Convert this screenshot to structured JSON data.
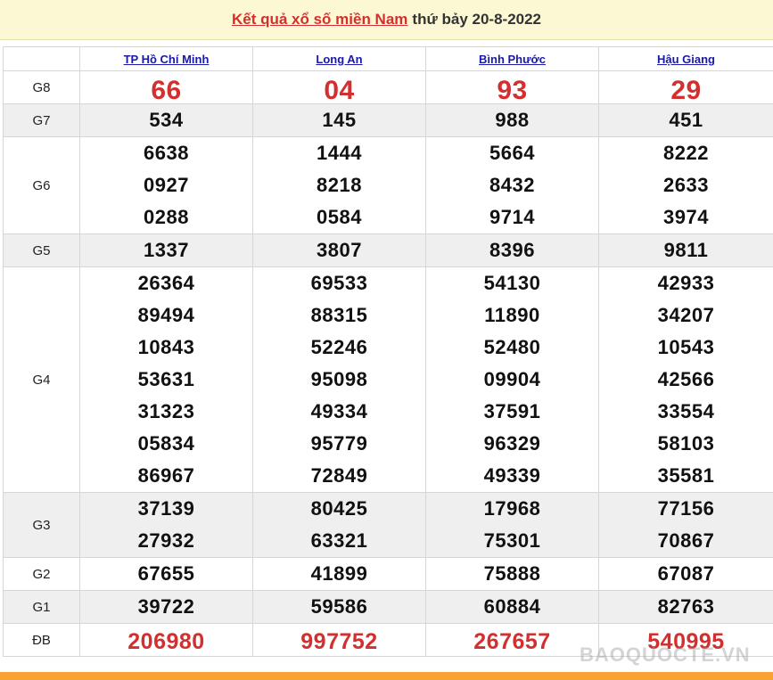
{
  "header": {
    "link_text": "Kết quả xổ số miền Nam",
    "rest_text": "thứ bảy 20-8-2022"
  },
  "provinces": [
    "TP Hồ Chí Minh",
    "Long An",
    "Bình Phước",
    "Hậu Giang"
  ],
  "prizes": [
    {
      "label": "G8",
      "results": [
        [
          "66"
        ],
        [
          "04"
        ],
        [
          "93"
        ],
        [
          "29"
        ]
      ]
    },
    {
      "label": "G7",
      "results": [
        [
          "534"
        ],
        [
          "145"
        ],
        [
          "988"
        ],
        [
          "451"
        ]
      ]
    },
    {
      "label": "G6",
      "results": [
        [
          "6638",
          "0927",
          "0288"
        ],
        [
          "1444",
          "8218",
          "0584"
        ],
        [
          "5664",
          "8432",
          "9714"
        ],
        [
          "8222",
          "2633",
          "3974"
        ]
      ]
    },
    {
      "label": "G5",
      "results": [
        [
          "1337"
        ],
        [
          "3807"
        ],
        [
          "8396"
        ],
        [
          "9811"
        ]
      ]
    },
    {
      "label": "G4",
      "results": [
        [
          "26364",
          "89494",
          "10843",
          "53631",
          "31323",
          "05834",
          "86967"
        ],
        [
          "69533",
          "88315",
          "52246",
          "95098",
          "49334",
          "95779",
          "72849"
        ],
        [
          "54130",
          "11890",
          "52480",
          "09904",
          "37591",
          "96329",
          "49339"
        ],
        [
          "42933",
          "34207",
          "10543",
          "42566",
          "33554",
          "58103",
          "35581"
        ]
      ]
    },
    {
      "label": "G3",
      "results": [
        [
          "37139",
          "27932"
        ],
        [
          "80425",
          "63321"
        ],
        [
          "17968",
          "75301"
        ],
        [
          "77156",
          "70867"
        ]
      ]
    },
    {
      "label": "G2",
      "results": [
        [
          "67655"
        ],
        [
          "41899"
        ],
        [
          "75888"
        ],
        [
          "67087"
        ]
      ]
    },
    {
      "label": "G1",
      "results": [
        [
          "39722"
        ],
        [
          "59586"
        ],
        [
          "60884"
        ],
        [
          "82763"
        ]
      ]
    },
    {
      "label": "ĐB",
      "results": [
        [
          "206980"
        ],
        [
          "997752"
        ],
        [
          "267657"
        ],
        [
          "540995"
        ]
      ]
    }
  ],
  "watermark": "BAOQUOCTE.VN",
  "colors": {
    "accent_red": "#d32f2f",
    "link_blue": "#1a1aa6",
    "header_bg": "#fcf8d3",
    "footer_orange": "#f7a233"
  }
}
